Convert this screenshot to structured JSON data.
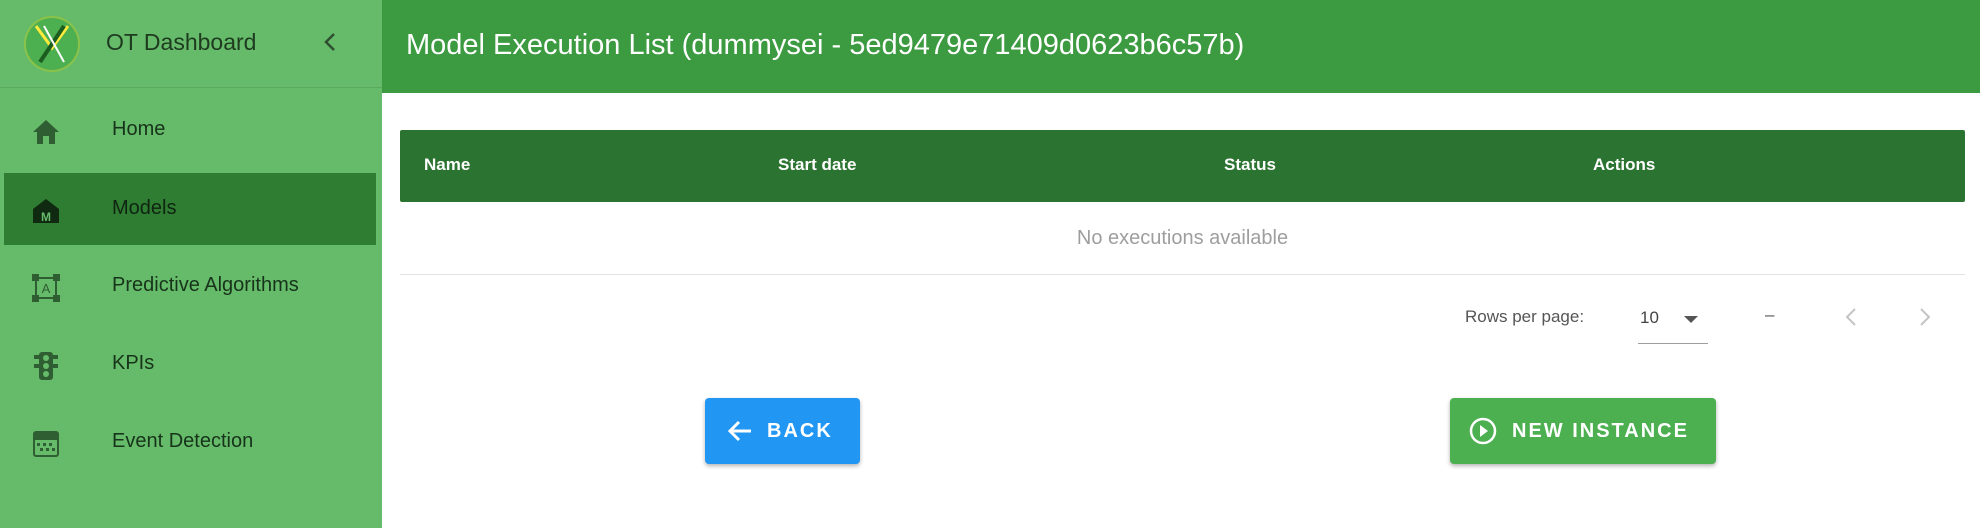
{
  "app": {
    "title": "OT Dashboard"
  },
  "sidebar": {
    "items": [
      {
        "label": "Home",
        "icon": "home-icon",
        "active": false
      },
      {
        "label": "Models",
        "icon": "model-building-icon",
        "active": true
      },
      {
        "label": "Predictive Algorithms",
        "icon": "algorithm-frame-icon",
        "active": false
      },
      {
        "label": "KPIs",
        "icon": "traffic-light-icon",
        "active": false
      },
      {
        "label": "Event Detection",
        "icon": "event-grid-icon",
        "active": false
      }
    ]
  },
  "header": {
    "title": "Model Execution List (dummysei - 5ed9479e71409d0623b6c57b)"
  },
  "table": {
    "columns": [
      "Name",
      "Start date",
      "Status",
      "Actions"
    ],
    "empty_message": "No executions available"
  },
  "pagination": {
    "rows_per_page_label": "Rows per page:",
    "rows_per_page_value": "10",
    "range": "–"
  },
  "buttons": {
    "back": "BACK",
    "new_instance": "NEW INSTANCE"
  },
  "colors": {
    "sidebar": "#66bb6a",
    "sidebar_active": "#2e7d32",
    "header": "#3c9a40",
    "table_header": "#2b7330",
    "back_button": "#2196f3",
    "new_button": "#4caf50"
  }
}
